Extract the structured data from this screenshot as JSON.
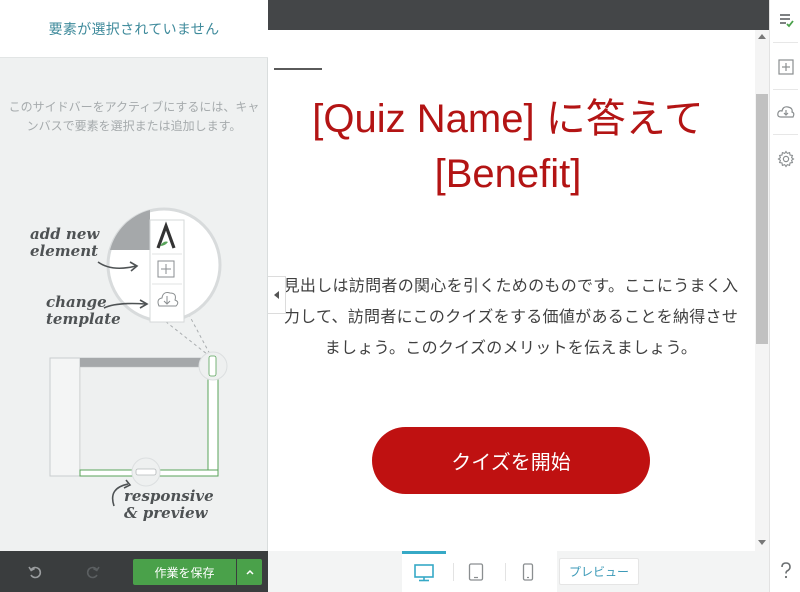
{
  "left_panel": {
    "header": "要素が選択されていません",
    "help_text": "このサイドバーをアクティブにするには、キャンバスで要素を選択または追加します。",
    "illustration": {
      "label_add": "add new element",
      "label_add_line1": "add new",
      "label_add_line2": "element",
      "label_change_line1": "change",
      "label_change_line2": "template",
      "label_responsive_line1": "responsive",
      "label_responsive_line2": "& preview"
    }
  },
  "bottom_bar": {
    "save_label": "作業を保存"
  },
  "canvas": {
    "headline_line1": "[Quiz Name] に答えて",
    "headline_line2": "[Benefit]",
    "body_text": "見出しは訪問者の関心を引くためのものです。ここにうまく入力して、訪問者にこのクイズをする価値があることを納得させましょう。このクイズのメリットを伝えましょう。",
    "cta_label": "クイズを開始"
  },
  "device_bar": {
    "preview_label": "プレビュー",
    "active_device": "desktop"
  },
  "colors": {
    "accent_red": "#bf1111",
    "headline_red": "#b31414",
    "save_green": "#4aa14a",
    "device_active_blue": "#36a9c6",
    "header_teal": "#3e8a9b"
  }
}
